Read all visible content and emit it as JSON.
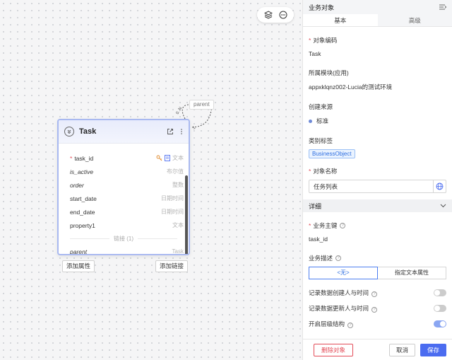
{
  "canvas": {
    "relation_label": "parent",
    "entity": {
      "title": "Task",
      "fields": [
        {
          "name": "task_id",
          "type": "文本",
          "required": true,
          "italic": false
        },
        {
          "name": "is_active",
          "type": "布尔值",
          "required": false,
          "italic": true
        },
        {
          "name": "order",
          "type": "整数",
          "required": false,
          "italic": true
        },
        {
          "name": "start_date",
          "type": "日期时间",
          "required": false,
          "italic": false
        },
        {
          "name": "end_date",
          "type": "日期时间",
          "required": false,
          "italic": false
        },
        {
          "name": "property1",
          "type": "文本",
          "required": false,
          "italic": false
        }
      ],
      "links_divider": "链接 (1)",
      "links": [
        {
          "name": "parent",
          "type": "Task"
        }
      ]
    },
    "add_property_label": "添加属性",
    "add_link_label": "添加链接"
  },
  "panel": {
    "title": "业务对象",
    "tabs": [
      {
        "label": "基本",
        "active": true
      },
      {
        "label": "高级",
        "active": false
      }
    ],
    "object_code_label": "对象编码",
    "object_code_value": "Task",
    "module_label": "所属模块(应用)",
    "module_value": "appxklqnz002-Lucia的测试环境",
    "source_label": "创建来源",
    "source_value": "标准",
    "category_label": "类别标签",
    "category_tag": "BusinessObject",
    "object_name_label": "对象名称",
    "object_name_value": "任务列表",
    "details_section": "详细",
    "primary_key_label": "业务主键",
    "primary_key_value": "task_id",
    "description_label": "业务描述",
    "description_options": [
      "<无>",
      "指定文本属性"
    ],
    "toggles": [
      {
        "label": "记录数据创建人与时间",
        "on": false
      },
      {
        "label": "记录数据更新人与时间",
        "on": false
      },
      {
        "label": "开启层级结构",
        "on": true
      }
    ],
    "delete_label": "删除对象",
    "cancel_label": "取消",
    "save_label": "保存"
  },
  "colors": {
    "primary": "#4b6cf0",
    "danger": "#e34d59",
    "tag_blue": "#2d6ee0",
    "entity_border": "#a9b9f0"
  }
}
